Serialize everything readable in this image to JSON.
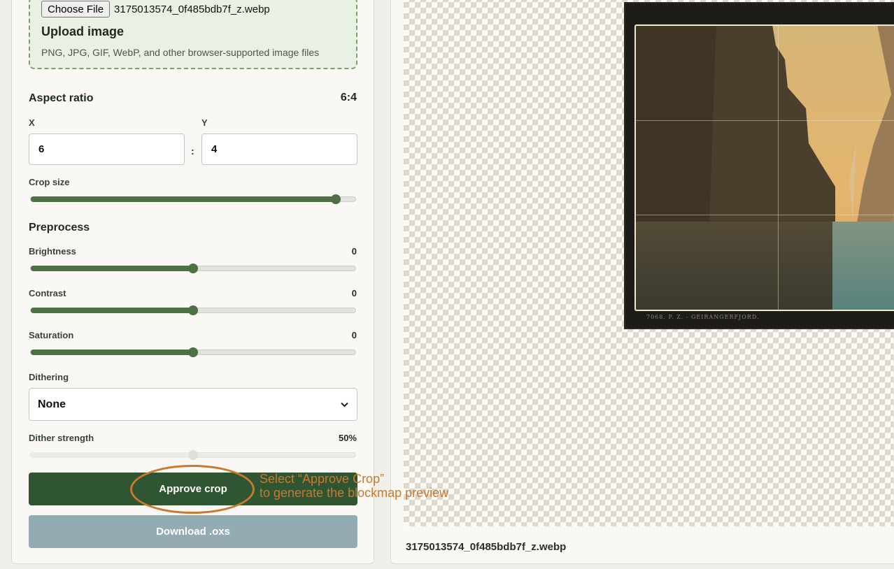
{
  "upload": {
    "choose_file_label": "Choose File",
    "file_name": "3175013574_0f485bdb7f_z.webp",
    "title": "Upload image",
    "hint": "PNG, JPG, GIF, WebP, and other browser-supported image files"
  },
  "aspect": {
    "label": "Aspect ratio",
    "ratio_display": "6:4",
    "x_label": "X",
    "y_label": "Y",
    "x_value": "6",
    "y_value": "4",
    "separator": ":"
  },
  "crop": {
    "label": "Crop size",
    "level_fraction": 0.94
  },
  "preprocess": {
    "label": "Preprocess",
    "brightness": {
      "label": "Brightness",
      "value": "0",
      "level_fraction": 0.5
    },
    "contrast": {
      "label": "Contrast",
      "value": "0",
      "level_fraction": 0.5
    },
    "saturation": {
      "label": "Saturation",
      "value": "0",
      "level_fraction": 0.5
    }
  },
  "dithering": {
    "label": "Dithering",
    "selected": "None",
    "strength_label": "Dither strength",
    "strength_value": "50%",
    "strength_fraction": 0.5
  },
  "actions": {
    "approve_label": "Approve crop",
    "download_label": "Download .oxs"
  },
  "preview": {
    "file_name": "3175013574_0f485bdb7f_z.webp",
    "photo_caption": "7068. P. Z. - GEIRANGERFJORD."
  },
  "annotation": {
    "line1": "Select “Approve Crop”",
    "line2": "to generate the blockmap preview"
  },
  "colors": {
    "accent_green": "#4e6e44",
    "approve_button": "#2f5532",
    "download_button": "#93abb3",
    "annotation": "#c97a2e"
  }
}
